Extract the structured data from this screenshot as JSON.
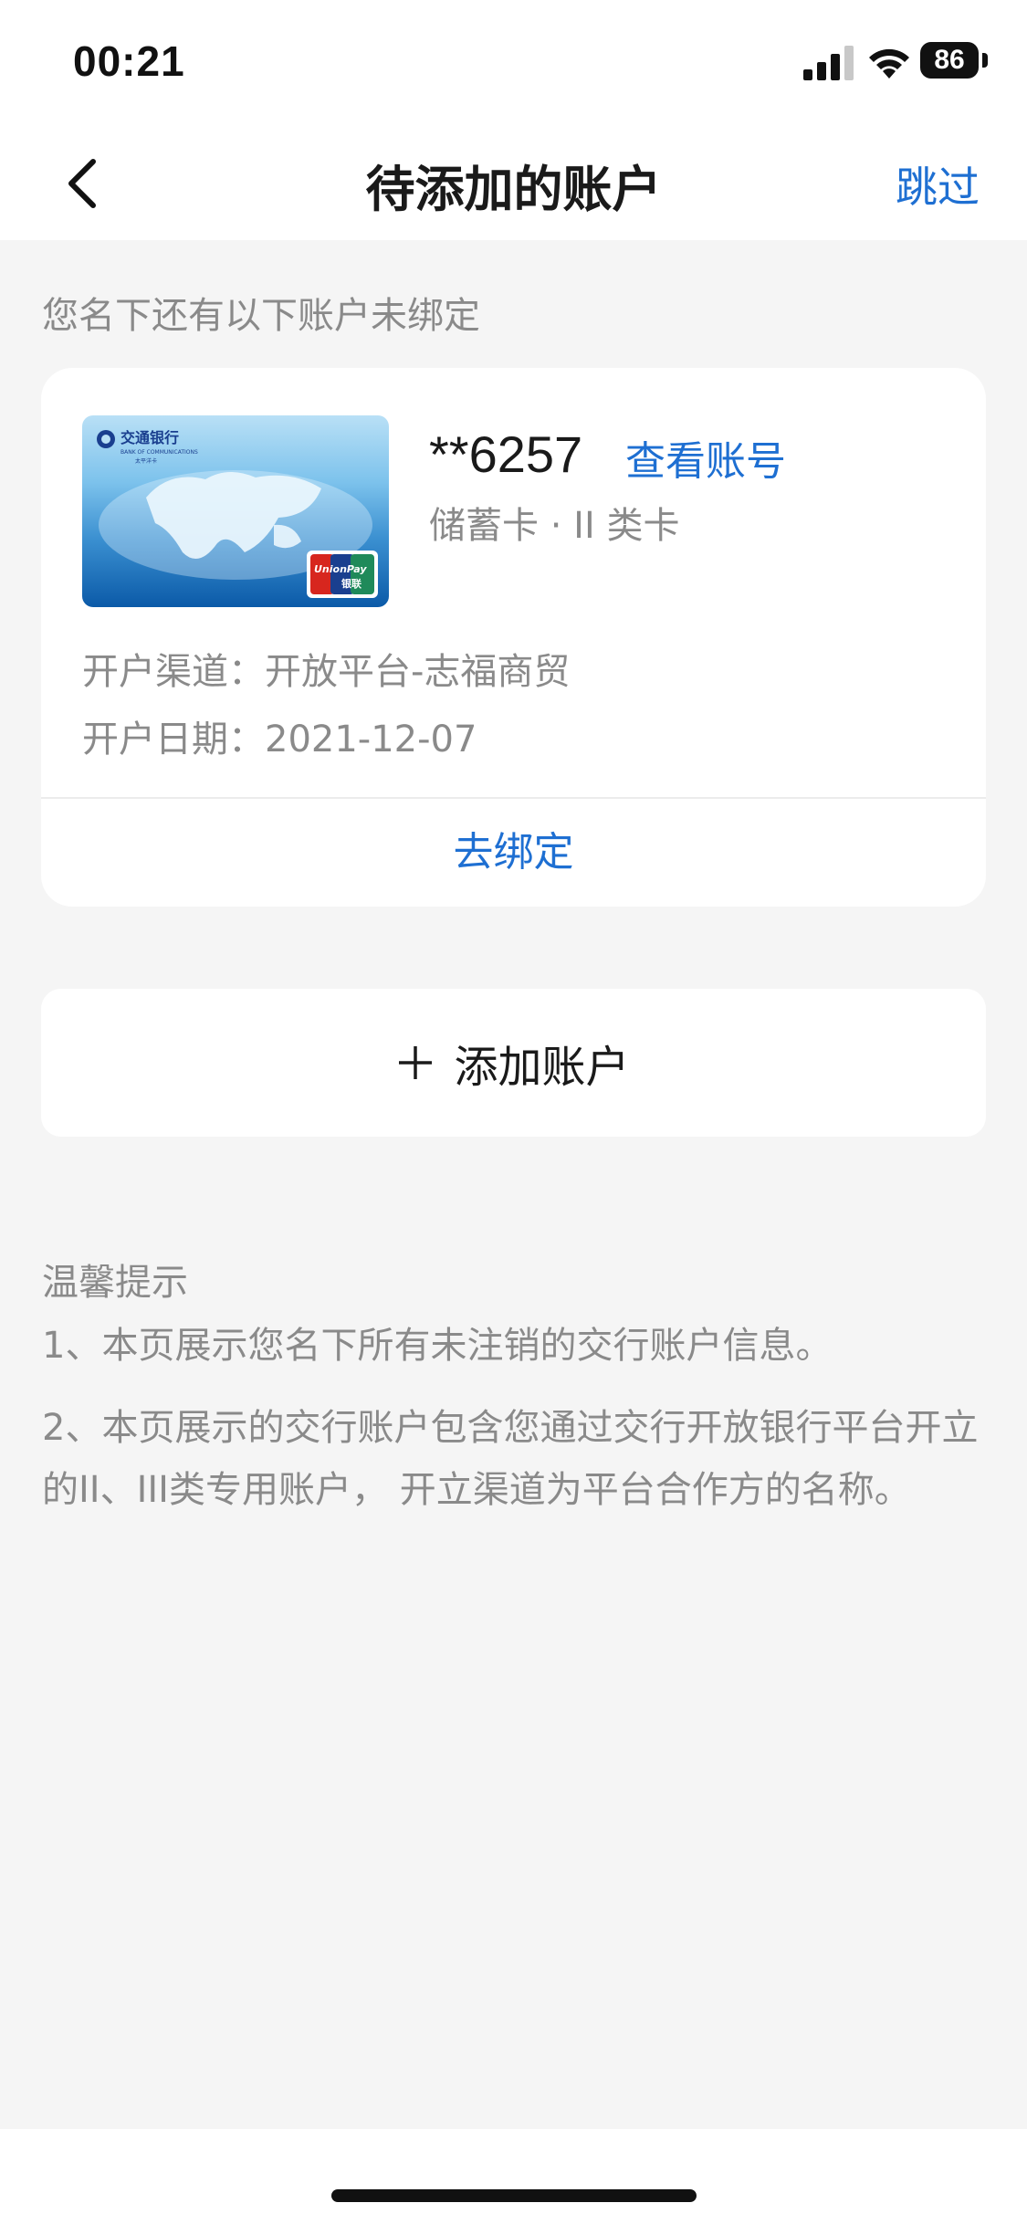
{
  "status_bar": {
    "time": "00:21",
    "battery": "86"
  },
  "nav": {
    "title": "待添加的账户",
    "skip_label": "跳过"
  },
  "section_hint": "您名下还有以下账户未绑定",
  "account": {
    "card_number": "**6257",
    "view_account_label": "查看账号",
    "card_type": "储蓄卡 · II 类卡",
    "channel": "开户渠道：开放平台-志福商贸",
    "open_date": "开户日期：2021-12-07",
    "bind_label": "去绑定",
    "card_image": {
      "bank_name": "交通银行",
      "bank_name_en": "BANK OF COMMUNICATIONS",
      "card_series": "太平洋卡",
      "network": "UnionPay",
      "network_cn": "银联"
    }
  },
  "add_account_label": "添加账户",
  "tips": {
    "title": "温馨提示",
    "items": [
      "1、本页展示您名下所有未注销的交行账户信息。",
      "2、本页展示的交行账户包含您通过交行开放银行平台开立的II、III类专用账户， 开立渠道为平台合作方的名称。"
    ]
  },
  "colors": {
    "accent": "#1e6fd2",
    "background": "#f5f5f5",
    "secondary_text": "#8a8a8a"
  }
}
